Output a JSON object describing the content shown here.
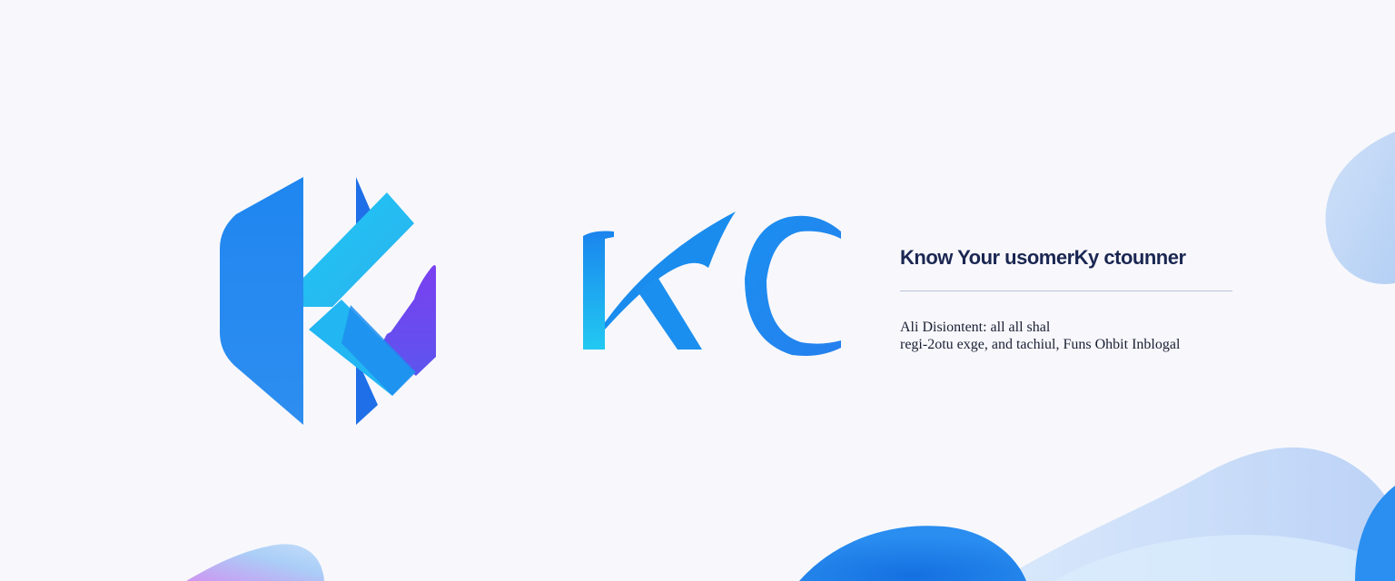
{
  "brand": {
    "wordmark": "KC",
    "tagline": "Know Your usomerKy ctounner",
    "description_lines": [
      "Ali Disiontent:  all all shal",
      "regi-2otu exge, and tachiul,  Funs Ohbit Inblogal"
    ],
    "logo_icon": "k-monogram-icon"
  },
  "colors": {
    "background": "#f8f8fc",
    "primary_blue": "#1e88ee",
    "light_cyan": "#22c8f2",
    "violet": "#6b45e8",
    "text_dark": "#1b2752"
  }
}
